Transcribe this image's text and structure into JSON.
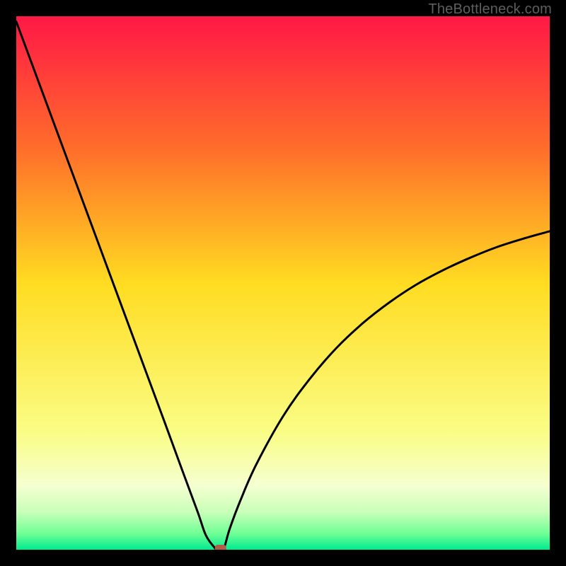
{
  "watermark": "TheBottleneck.com",
  "chart_data": {
    "type": "line",
    "title": "",
    "xlabel": "",
    "ylabel": "",
    "xlim": [
      0,
      100
    ],
    "ylim": [
      0,
      100
    ],
    "legend": false,
    "grid": false,
    "background_gradient": {
      "stops": [
        {
          "pct": 0,
          "color": "#ff1846"
        },
        {
          "pct": 25,
          "color": "#ff6e2a"
        },
        {
          "pct": 50,
          "color": "#ffdc21"
        },
        {
          "pct": 78,
          "color": "#fafd85"
        },
        {
          "pct": 88,
          "color": "#f5ffd0"
        },
        {
          "pct": 93,
          "color": "#c8ffb9"
        },
        {
          "pct": 97,
          "color": "#6eff95"
        },
        {
          "pct": 100,
          "color": "#00eb8e"
        }
      ]
    },
    "series": [
      {
        "name": "bottleneck-curve",
        "x": [
          0,
          5,
          10,
          15,
          20,
          25,
          28,
          31,
          34,
          35.5,
          37,
          37.7,
          38.8,
          40,
          42,
          45,
          50,
          55,
          60,
          65,
          70,
          75,
          80,
          85,
          90,
          95,
          100
        ],
        "y": [
          99,
          85.5,
          72,
          58.5,
          45,
          31.5,
          23.4,
          15.2,
          7.1,
          2.8,
          0.6,
          0.0,
          0.0,
          3.9,
          9.2,
          16.0,
          25.0,
          32.0,
          37.8,
          42.5,
          46.4,
          49.7,
          52.4,
          54.7,
          56.7,
          58.3,
          59.7
        ]
      }
    ],
    "marker": {
      "name": "optimum-marker",
      "x": 38.3,
      "y": 0,
      "color": "#b35c4a"
    }
  }
}
